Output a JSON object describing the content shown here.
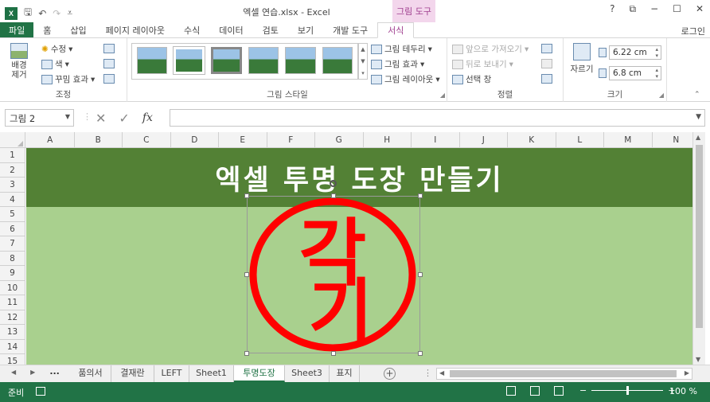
{
  "app": {
    "window_title": "엑셀 연습.xlsx - Excel",
    "context_tab_header": "그림 도구",
    "login": "로그인"
  },
  "title_bar": {
    "app_logo": "X",
    "win_controls": [
      "?",
      "⧉",
      "−",
      "☐",
      "✕"
    ]
  },
  "tabs": [
    "파일",
    "홈",
    "삽입",
    "페이지 레이아웃",
    "수식",
    "데이터",
    "검토",
    "보기",
    "개발 도구",
    "서식"
  ],
  "active_tab": "서식",
  "ribbon": {
    "adjust": {
      "remove_bg": "배경 제거",
      "corrections": "수정",
      "color": "색",
      "artistic": "꾸밈 효과",
      "label": "조정"
    },
    "picture_styles": {
      "border": "그림 테두리",
      "effects": "그림 효과",
      "layout": "그림 레이아웃",
      "label": "그림 스타일"
    },
    "arrange": {
      "bring_forward": "앞으로 가져오기",
      "send_backward": "뒤로 보내기",
      "selection_pane": "선택 창",
      "label": "정렬"
    },
    "size": {
      "crop": "자르기",
      "height": "6.22 cm",
      "width": "6.8 cm",
      "label": "크기"
    }
  },
  "formula_bar": {
    "name_box": "그림 2",
    "fx": "fx",
    "value": ""
  },
  "columns": [
    "A",
    "B",
    "C",
    "D",
    "E",
    "F",
    "G",
    "H",
    "I",
    "J",
    "K",
    "L",
    "M",
    "N"
  ],
  "rows": [
    "1",
    "2",
    "3",
    "4",
    "5",
    "6",
    "7",
    "8",
    "9",
    "10",
    "11",
    "12",
    "13",
    "14",
    "15"
  ],
  "sheet": {
    "header_text": "엑셀 투명 도장 만들기",
    "stamp_text": [
      "각",
      "기"
    ],
    "stamp_color": "#ff0000",
    "header_fill": "#538135",
    "body_fill": "#a9d08e"
  },
  "sheet_tabs": [
    "...",
    "품의서",
    "결재란",
    "LEFT",
    "Sheet1",
    "투명도장",
    "Sheet3",
    "표지"
  ],
  "active_sheet": "투명도장",
  "status": {
    "ready": "준비",
    "zoom": "100 %",
    "zoom_level": 1.0
  }
}
